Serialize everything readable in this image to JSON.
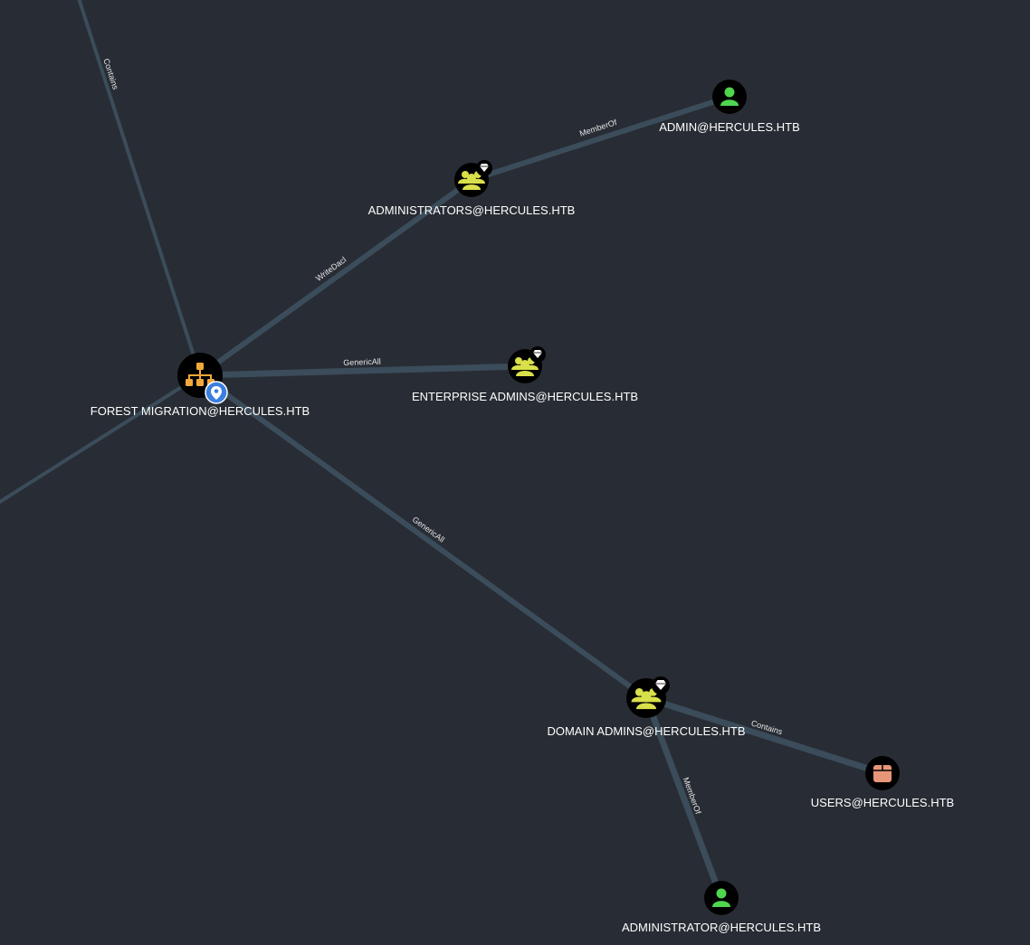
{
  "graph": {
    "background": "#282c34",
    "edge_color": "#3b4c5a",
    "nodes": {
      "forest_migration": {
        "label": "FOREST MIGRATION@HERCULES.HTB",
        "kind": "ou",
        "icon": "sitemap-icon",
        "color": "#f2a93b",
        "marker": "location-pin-icon"
      },
      "administrators": {
        "label": "ADMINISTRATORS@HERCULES.HTB",
        "kind": "group",
        "icon": "group-icon",
        "color": "#d9e04a",
        "badge": "diamond-icon"
      },
      "admin": {
        "label": "ADMIN@HERCULES.HTB",
        "kind": "user",
        "icon": "user-icon",
        "color": "#4fd64f"
      },
      "enterprise_admins": {
        "label": "ENTERPRISE ADMINS@HERCULES.HTB",
        "kind": "group",
        "icon": "group-icon",
        "color": "#d9e04a",
        "badge": "diamond-icon"
      },
      "domain_admins": {
        "label": "DOMAIN ADMINS@HERCULES.HTB",
        "kind": "group",
        "icon": "group-icon",
        "color": "#d9e04a",
        "badge": "diamond-icon"
      },
      "users": {
        "label": "USERS@HERCULES.HTB",
        "kind": "container",
        "icon": "box-icon",
        "color": "#e8967a"
      },
      "administrator": {
        "label": "ADMINISTRATOR@HERCULES.HTB",
        "kind": "user",
        "icon": "user-icon",
        "color": "#4fd64f"
      }
    },
    "edges": {
      "contains_top": {
        "label": "Contains"
      },
      "memberof_admin": {
        "label": "MemberOf"
      },
      "writedacl": {
        "label": "WriteDacl"
      },
      "genericall_ea": {
        "label": "GenericAll"
      },
      "genericall_da": {
        "label": "GenericAll"
      },
      "contains_users": {
        "label": "Contains"
      },
      "memberof_administrator": {
        "label": "MemberOf"
      }
    }
  }
}
